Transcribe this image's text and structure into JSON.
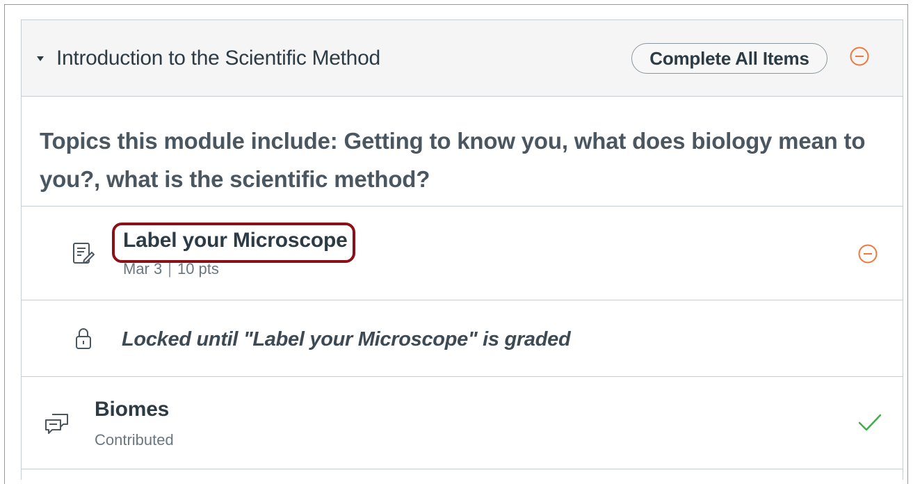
{
  "module": {
    "title": "Introduction to the Scientific Method",
    "requirement": "Complete All Items",
    "overview": "Topics this module include: Getting to know you, what does biology mean to you?, what is the scientific method?"
  },
  "items": {
    "assignment": {
      "title": "Label your Microscope",
      "date": "Mar 3",
      "separator": "|",
      "points": "10 pts"
    },
    "locked": {
      "text": "Locked until \"Label your Microscope\" is graded"
    },
    "discussion": {
      "title": "Biomes",
      "status": "Contributed"
    }
  },
  "colors": {
    "accent_orange": "#f0783c",
    "complete_green": "#3fae49",
    "highlight_red": "#8b1018"
  },
  "icons": {
    "collapse": "caret-down-icon",
    "min_requirement": "minus-circle-icon",
    "assignment": "assignment-icon",
    "lock": "lock-icon",
    "discussion": "discussion-icon",
    "complete": "checkmark-icon"
  }
}
